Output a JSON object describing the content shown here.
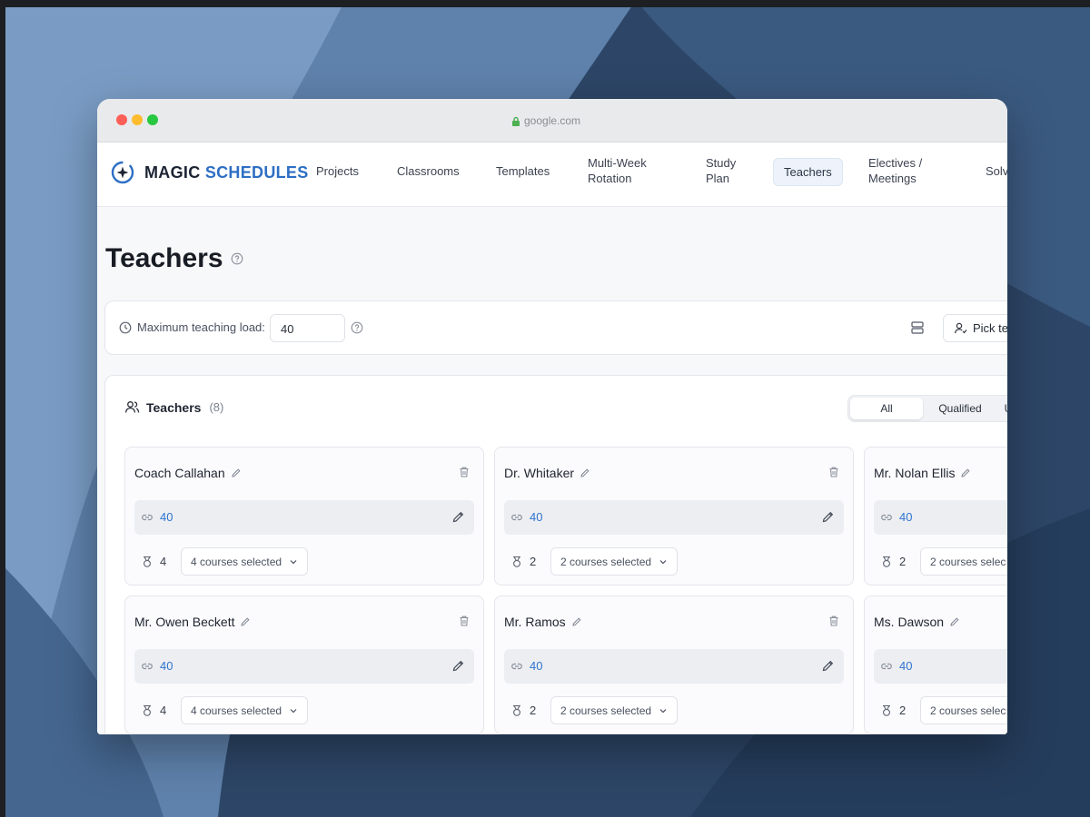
{
  "browser": {
    "url": "google.com"
  },
  "app": {
    "brand_first": "MAGIC",
    "brand_second": "SCHEDULES"
  },
  "nav": {
    "items": [
      {
        "label": "Projects"
      },
      {
        "label": "Classrooms"
      },
      {
        "label": "Templates"
      },
      {
        "label": "Multi-Week Rotation"
      },
      {
        "label": "Study Plan"
      },
      {
        "label": "Teachers"
      },
      {
        "label": "Electives / Meetings"
      },
      {
        "label": "Solv"
      }
    ],
    "active": "Teachers"
  },
  "page": {
    "title": "Teachers"
  },
  "settings": {
    "load_label": "Maximum teaching load:",
    "load_value": "40",
    "pick_label": "Pick te"
  },
  "teachers_section": {
    "title": "Teachers",
    "count": "(8)",
    "filters": {
      "all": "All",
      "qualified": "Qualified",
      "third": "U"
    }
  },
  "teachers": [
    {
      "name": "Coach Callahan",
      "load": "40",
      "course_count": "4",
      "courses": "4 courses selected"
    },
    {
      "name": "Dr. Whitaker",
      "load": "40",
      "course_count": "2",
      "courses": "2 courses selected"
    },
    {
      "name": "Mr. Nolan Ellis",
      "load": "40",
      "course_count": "2",
      "courses": "2 courses selec"
    },
    {
      "name": "Mr. Owen Beckett",
      "load": "40",
      "course_count": "4",
      "courses": "4 courses selected"
    },
    {
      "name": "Mr. Ramos",
      "load": "40",
      "course_count": "2",
      "courses": "2 courses selected"
    },
    {
      "name": "Ms. Dawson",
      "load": "40",
      "course_count": "2",
      "courses": "2 courses selec"
    }
  ],
  "colors": {
    "accent": "#2d6fc4",
    "link_value": "#2f74d0",
    "desktop": "#2f4a6c"
  }
}
